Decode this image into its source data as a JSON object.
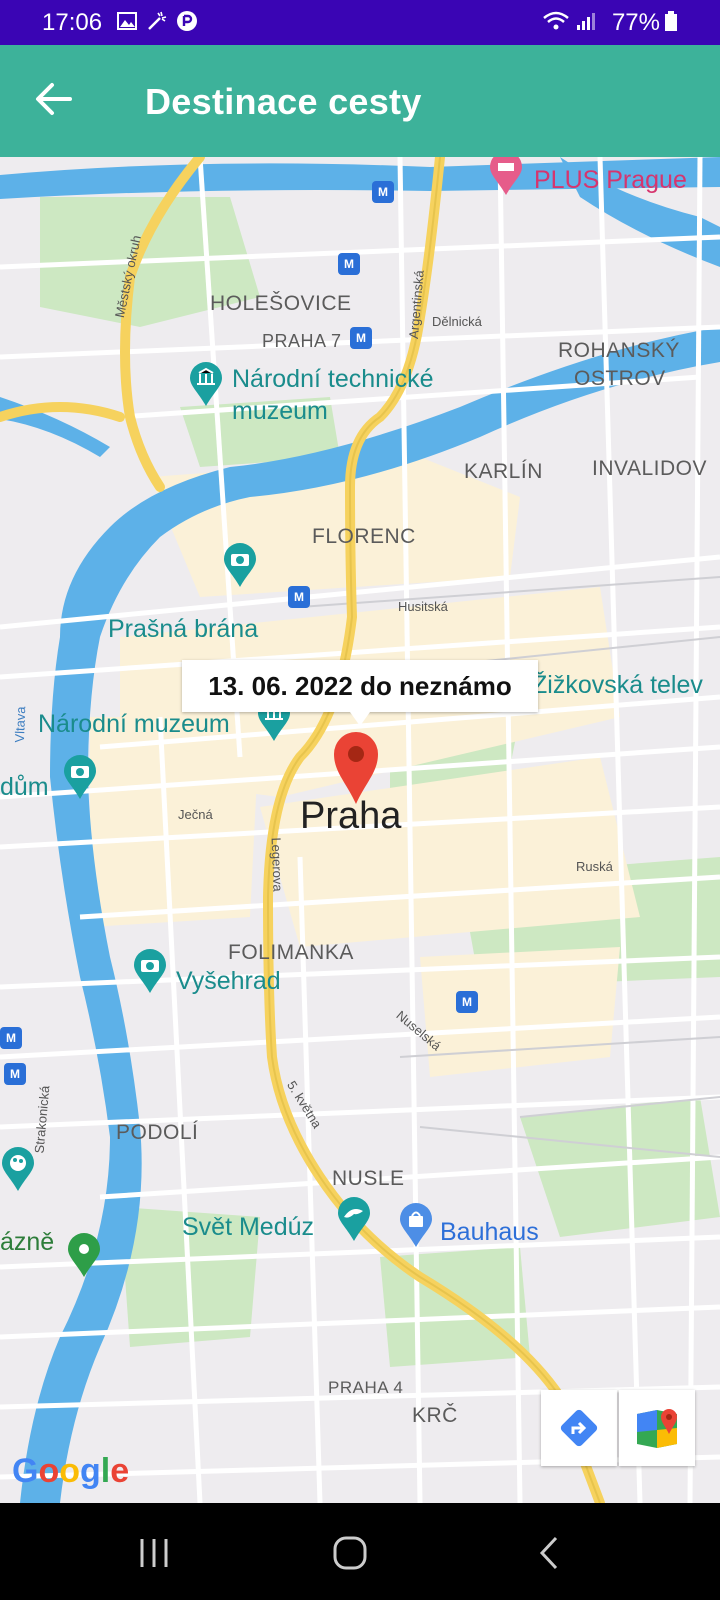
{
  "status": {
    "time": "17:06",
    "battery": "77%"
  },
  "header": {
    "title": "Destinace cesty"
  },
  "map": {
    "info_window": "13. 06. 2022 do neznámo",
    "city": "Praha",
    "districts": [
      "HOLEŠOVICE",
      "PRAHA 7",
      "ROHANSKÝ",
      "OSTROV",
      "KARLÍN",
      "INVALIDOV",
      "FLORENC",
      "FOLIMANKA",
      "PODOLÍ",
      "NUSLE",
      "PRAHA 4",
      "KRČ"
    ],
    "pois": {
      "plus_prague": "PLUS Prague",
      "ntm_1": "Národní technické",
      "ntm_2": "muzeum",
      "prasna_brana": "Prašná brána",
      "narodni_muzeum": "Národní muzeum",
      "zizkovska": "Žižkovská telev",
      "dum": "dům",
      "vysehrad": "Vyšehrad",
      "svet_meduz": "Svět Medúz",
      "bauhaus": "Bauhaus",
      "razne": "ázně"
    },
    "streets": {
      "mestsky_okruh": "Městský okruh",
      "argentinska": "Argentinská",
      "delnicka": "Dělnická",
      "husitska": "Husitská",
      "vltava": "Vltava",
      "jecna": "Ječná",
      "legerova": "Legerova",
      "ruska": "Ruská",
      "nuselska": "Nuselská",
      "petkvetna": "5. května",
      "strakonicka": "Strakonická"
    },
    "logo": "Google"
  },
  "colors": {
    "status_bar": "#3a05b4",
    "app_bar": "#3db29a",
    "water": "#5db1e8",
    "road": "#f6d25e",
    "marker": "#ea4335"
  }
}
